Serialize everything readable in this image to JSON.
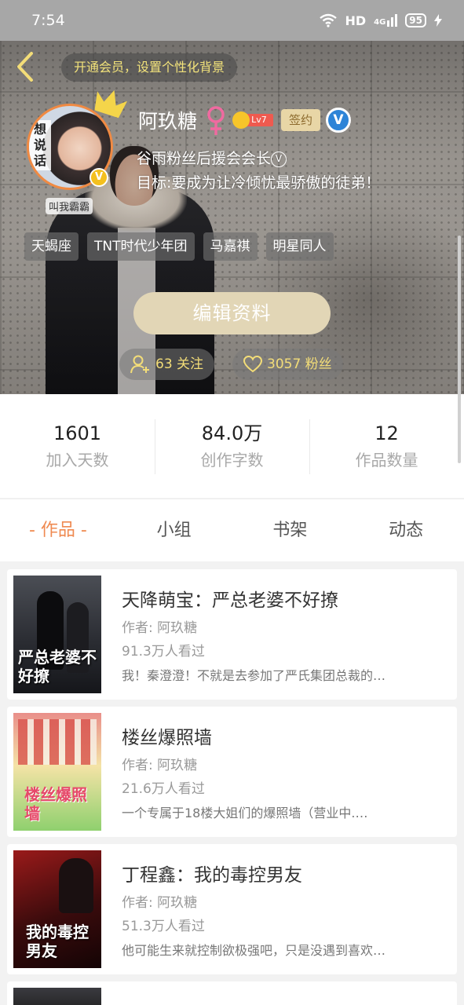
{
  "status_bar": {
    "time": "7:54",
    "network": "HD",
    "signal": "4G",
    "battery": "95"
  },
  "header": {
    "vip_banner": "开通会员，设置个性化背景"
  },
  "profile": {
    "avatar_text": "想说话",
    "avatar_tag": "叫我霸霸",
    "name": "阿玖糖",
    "level": "Lv7",
    "sign_badge": "签约",
    "bio_line1": "谷雨粉丝后援会会长",
    "bio_line2": "目标:要成为让冷倾忧最骄傲的徒弟！",
    "tags": [
      "天蝎座",
      "TNT时代少年团",
      "马嘉祺",
      "明星同人"
    ],
    "edit_button": "编辑资料",
    "following": "63 关注",
    "fans": "3057 粉丝"
  },
  "stats": [
    {
      "value": "1601",
      "label": "加入天数"
    },
    {
      "value": "84.0万",
      "label": "创作字数"
    },
    {
      "value": "12",
      "label": "作品数量"
    }
  ],
  "tabs": [
    "- 作品 -",
    "小组",
    "书架",
    "动态"
  ],
  "books": [
    {
      "title": "天降萌宝：严总老婆不好撩",
      "author": "作者: 阿玖糖",
      "reads": "91.3万人看过",
      "desc": "我！秦澄澄！不就是去参加了严氏集团总裁的…",
      "cover_text": "严总老婆不好撩"
    },
    {
      "title": "楼丝爆照墙",
      "author": "作者: 阿玖糖",
      "reads": "21.6万人看过",
      "desc": "一个专属于18楼大姐们的爆照墙（营业中.…",
      "cover_text": "楼丝爆照墙"
    },
    {
      "title": "丁程鑫：我的毒控男友",
      "author": "作者: 阿玖糖",
      "reads": "51.3万人看过",
      "desc": "他可能生来就控制欲极强吧，只是没遇到喜欢…",
      "cover_text": "我的毒控男友"
    }
  ],
  "colors": {
    "accent": "#ef8a51",
    "gold": "#f3dd78",
    "edit_button": "#e2d6b6"
  }
}
